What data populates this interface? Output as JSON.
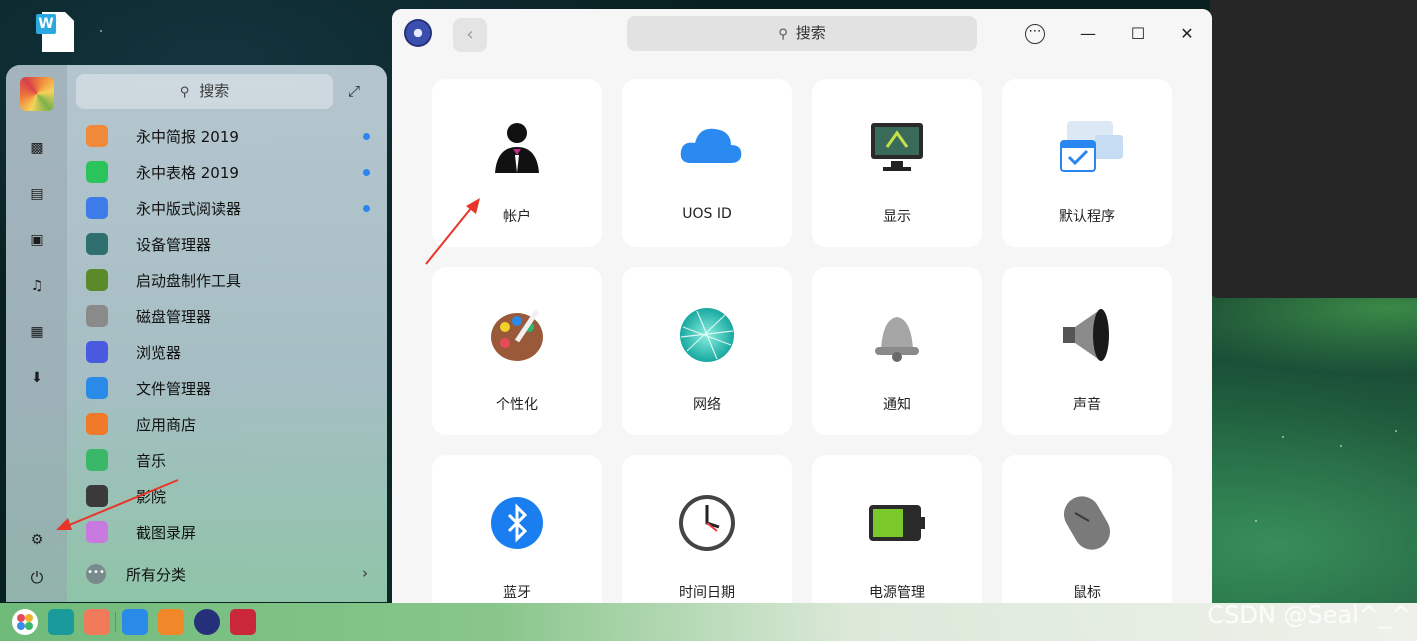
{
  "launcher": {
    "search_placeholder": "搜索",
    "apps": [
      {
        "label": "永中简报 2019",
        "icon": "yozo-presentation-icon",
        "color": "#f08a3a",
        "new": true
      },
      {
        "label": "永中表格 2019",
        "icon": "yozo-spreadsheet-icon",
        "color": "#2bc45a",
        "new": true
      },
      {
        "label": "永中版式阅读器",
        "icon": "yozo-reader-icon",
        "color": "#3c7be8",
        "new": true
      },
      {
        "label": "设备管理器",
        "icon": "device-manager-icon",
        "color": "#2f6f6f",
        "new": false
      },
      {
        "label": "启动盘制作工具",
        "icon": "boot-maker-icon",
        "color": "#5a8a2a",
        "new": false
      },
      {
        "label": "磁盘管理器",
        "icon": "disk-manager-icon",
        "color": "#8a8a8a",
        "new": false
      },
      {
        "label": "浏览器",
        "icon": "browser-icon",
        "color": "#4a5ae0",
        "new": false
      },
      {
        "label": "文件管理器",
        "icon": "file-manager-icon",
        "color": "#2a8ae8",
        "new": false
      },
      {
        "label": "应用商店",
        "icon": "app-store-icon",
        "color": "#f07a2a",
        "new": false
      },
      {
        "label": "音乐",
        "icon": "music-icon",
        "color": "#3ab86a",
        "new": false
      },
      {
        "label": "影院",
        "icon": "movie-icon",
        "color": "#3a3a3a",
        "new": false
      },
      {
        "label": "截图录屏",
        "icon": "screenshot-icon",
        "color": "#c87ae0",
        "new": false
      }
    ],
    "all_categories": "所有分类"
  },
  "control_center": {
    "search_placeholder": "搜索",
    "tiles": [
      {
        "label": "帐户",
        "icon": "account-icon"
      },
      {
        "label": "UOS ID",
        "icon": "cloud-icon"
      },
      {
        "label": "显示",
        "icon": "display-icon"
      },
      {
        "label": "默认程序",
        "icon": "default-apps-icon"
      },
      {
        "label": "个性化",
        "icon": "personalization-icon"
      },
      {
        "label": "网络",
        "icon": "network-icon"
      },
      {
        "label": "通知",
        "icon": "notification-icon"
      },
      {
        "label": "声音",
        "icon": "sound-icon"
      },
      {
        "label": "蓝牙",
        "icon": "bluetooth-icon"
      },
      {
        "label": "时间日期",
        "icon": "datetime-icon"
      },
      {
        "label": "电源管理",
        "icon": "power-management-icon"
      },
      {
        "label": "鼠标",
        "icon": "mouse-icon"
      }
    ]
  },
  "watermark": "CSDN @Seal^_^",
  "colors": {
    "accent": "#2a86f0",
    "arrow": "#e8352a"
  }
}
